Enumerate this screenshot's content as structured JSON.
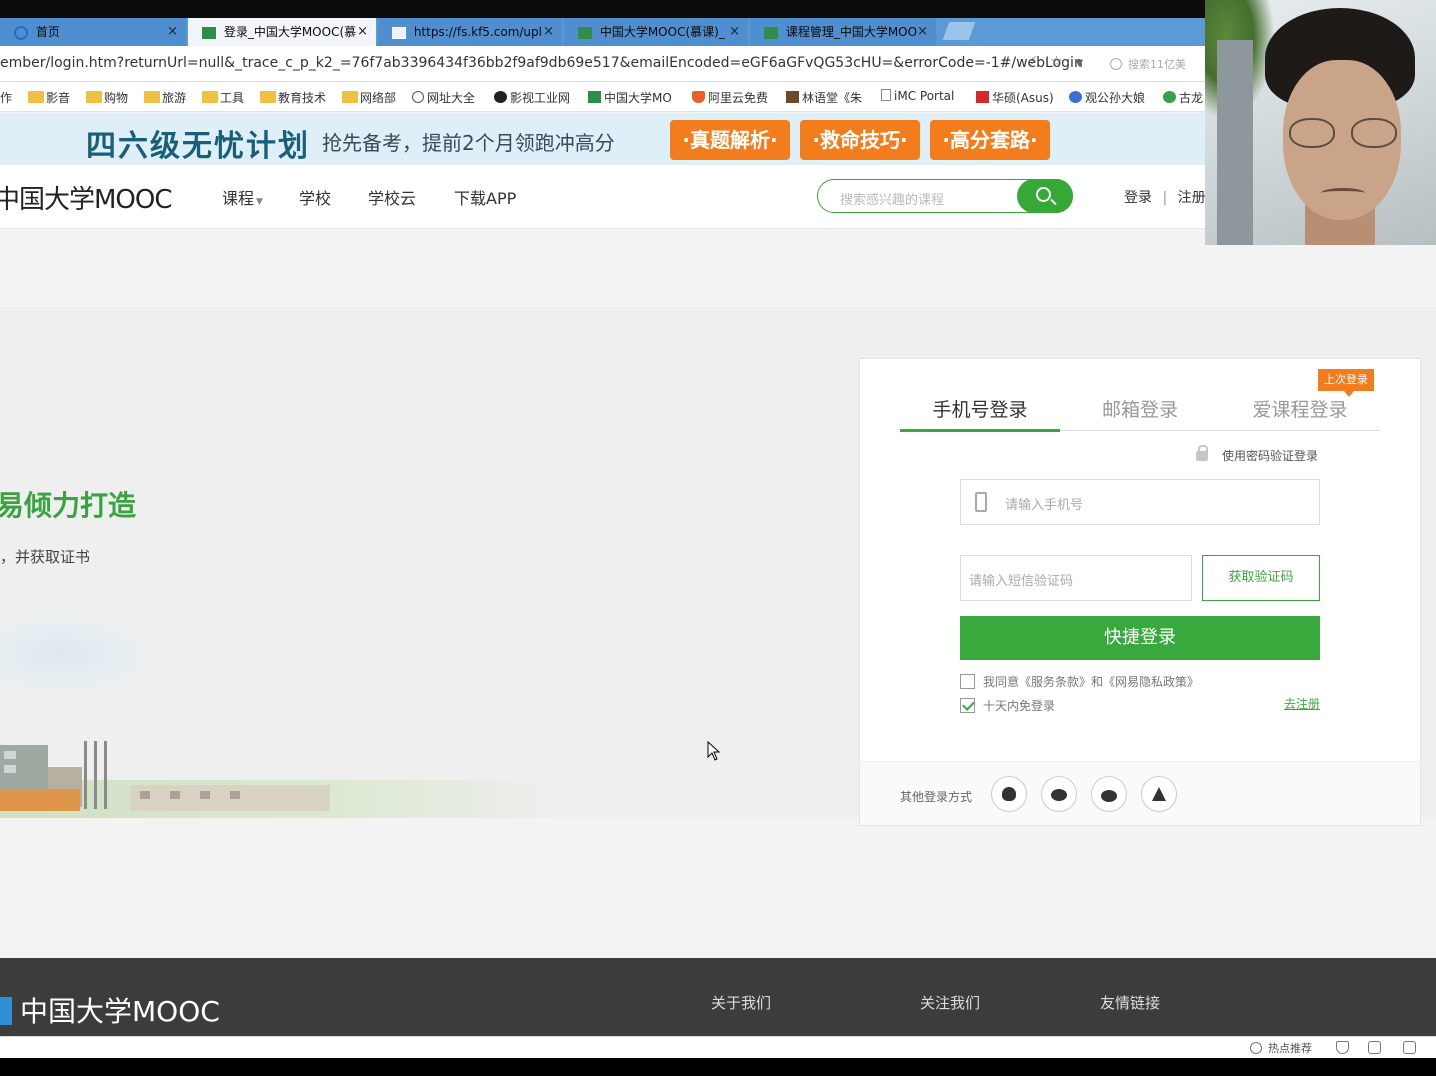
{
  "browser": {
    "tabs": [
      {
        "label": "首页",
        "active": false
      },
      {
        "label": "登录_中国大学MOOC(慕",
        "active": true
      },
      {
        "label": "https://fs.kf5.com/upl",
        "active": false
      },
      {
        "label": "中国大学MOOC(慕课)_",
        "active": false
      },
      {
        "label": "课程管理_中国大学MOO",
        "active": false
      }
    ],
    "address": "ember/login.htm?returnUrl=null&_trace_c_p_k2_=76f7ab3396434f36bb2f9af9db69e517&emailEncoded=eGF6aGFvQG53cHU=&errorCode=-1#/webLogin",
    "search_hint": "搜索11亿美",
    "bookmarks": [
      "作",
      "影音",
      "购物",
      "旅游",
      "工具",
      "教育技术",
      "网络部",
      "网址大全",
      "影视工业网",
      "中国大学MO",
      "阿里云免费",
      "林语堂《朱",
      "iMC Portal",
      "华硕(Asus)",
      "观公孙大娘",
      "古龙"
    ]
  },
  "banner": {
    "title": "四六级无忧计划",
    "subtitle": "抢先备考，提前2个月领跑冲高分",
    "buttons": [
      "·真题解析·",
      "·救命技巧·",
      "·高分套路·"
    ]
  },
  "header": {
    "logo": "中国大学MOOC",
    "nav": [
      "课程",
      "学校",
      "学校云",
      "下载APP"
    ],
    "search_placeholder": "搜索感兴趣的课程",
    "login": "登录",
    "separator": "|",
    "register": "注册"
  },
  "hero": {
    "headline": "易倾力打造",
    "subline": "，并获取证书"
  },
  "login_card": {
    "tabs": [
      "手机号登录",
      "邮箱登录",
      "爱课程登录"
    ],
    "last_login_badge": "上次登录",
    "password_login_link": "使用密码验证登录",
    "phone_placeholder": "请输入手机号",
    "sms_placeholder": "请输入短信验证码",
    "get_code_button": "获取验证码",
    "submit_button": "快捷登录",
    "agree_text": "我同意《服务条款》和《网易隐私政策》",
    "remember_text": "十天内免登录",
    "register_link": "去注册",
    "other_login_label": "其他登录方式",
    "agree_checked": false,
    "remember_checked": true
  },
  "footer": {
    "logo": "中国大学MOOC",
    "columns": [
      "关于我们",
      "关注我们",
      "友情链接"
    ]
  },
  "statusbar": {
    "hot": "热点推荐"
  },
  "colors": {
    "brand_green": "#39a83d",
    "banner_orange": "#f37c1d",
    "tab_blue": "#5b9bd5",
    "footer_dark": "#3c3c3c"
  }
}
